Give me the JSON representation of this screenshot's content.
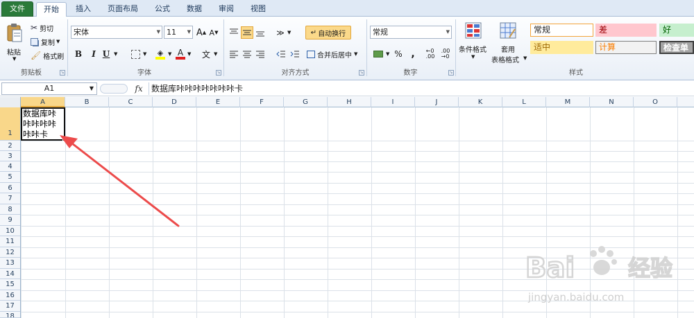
{
  "tabs": [
    "文件",
    "开始",
    "插入",
    "页面布局",
    "公式",
    "数据",
    "审阅",
    "视图"
  ],
  "clipboard": {
    "paste": "粘贴",
    "cut": "剪切",
    "copy": "复制",
    "format_painter": "格式刷",
    "group": "剪贴板"
  },
  "font": {
    "name": "宋体",
    "size": "11",
    "bold": "B",
    "italic": "I",
    "underline": "U",
    "group": "字体"
  },
  "alignment": {
    "wrap": "自动换行",
    "merge": "合并后居中",
    "group": "对齐方式"
  },
  "number": {
    "format": "常规",
    "percent": "%",
    "comma": ",",
    "group": "数字"
  },
  "styles": {
    "cond_format": "条件格式",
    "table_format_1": "套用",
    "table_format_2": "表格格式",
    "normal": "常规",
    "bad": "差",
    "good": "好",
    "neutral": "适中",
    "calc": "计算",
    "check": "检查单",
    "group": "样式"
  },
  "formula_bar": {
    "name_box": "A1",
    "fx": "fx",
    "content": "数据库咔咔咔咔咔咔咔卡"
  },
  "columns": [
    "A",
    "B",
    "C",
    "D",
    "E",
    "F",
    "G",
    "H",
    "I",
    "J",
    "K",
    "L",
    "M",
    "N",
    "O"
  ],
  "rows": [
    "1",
    "2",
    "3",
    "4",
    "5",
    "6",
    "7",
    "8",
    "9",
    "10",
    "11",
    "12",
    "13",
    "14",
    "15",
    "16",
    "17",
    "18"
  ],
  "cell_a1": "数据库咔咔咔咔咔咔咔卡",
  "watermark": {
    "brand": "Bai du 经验",
    "url": "jingyan.baidu.com"
  },
  "colors": {
    "file_tab": "#2a7a3a",
    "selection_header": "#f9d78a",
    "arrow": "#ec4b4b"
  }
}
